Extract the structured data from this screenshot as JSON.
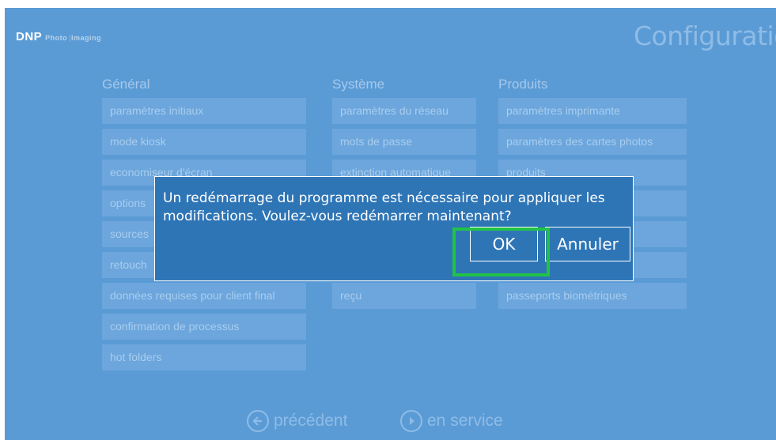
{
  "header": {
    "logo_main": "DNP",
    "logo_sub": "Photo",
    "logo_sub2": "Imaging",
    "title": "Configuration"
  },
  "columns": [
    {
      "heading": "Général",
      "items": [
        "paramètres initiaux",
        "mode kiosk",
        "economiseur d'écran",
        "options",
        "sources",
        "retouch",
        "données requises pour client final",
        "confirmation de processus",
        "hot folders"
      ]
    },
    {
      "heading": "Système",
      "items": [
        "paramètres du réseau",
        "mots de passe",
        "extinction automatique",
        "",
        "",
        "",
        "reçu"
      ]
    },
    {
      "heading": "Produits",
      "items": [
        "paramètres imprimante",
        "paramètres des cartes photos",
        "produits",
        "",
        "",
        "",
        "passeports biométriques"
      ]
    }
  ],
  "footer": {
    "back_label": "précédent",
    "forward_label": "en service"
  },
  "dialog": {
    "message": "Un redémarrage du programme est nécessaire pour appliquer les modifications. Voulez-vous redémarrer maintenant?",
    "ok_label": "OK",
    "cancel_label": "Annuler"
  },
  "colors": {
    "background": "#5b9bd5",
    "dialog": "#2e75b6",
    "highlight": "#21c346"
  }
}
